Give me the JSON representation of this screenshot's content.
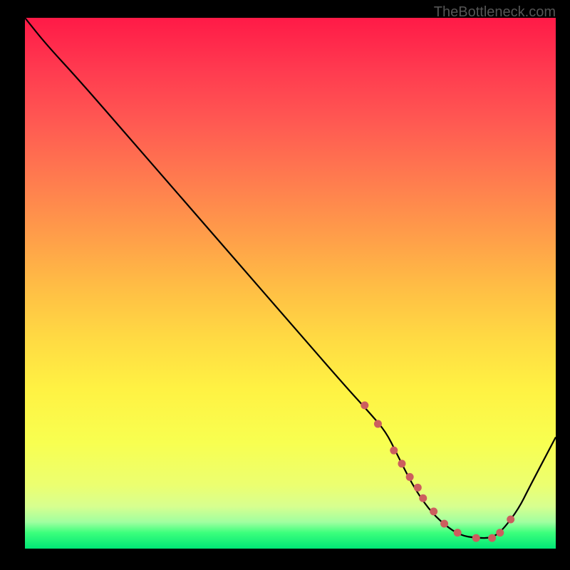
{
  "attribution": "TheBottleneck.com",
  "chart_data": {
    "type": "line",
    "title": "",
    "xlabel": "",
    "ylabel": "",
    "xlim": [
      0,
      100
    ],
    "ylim": [
      0,
      100
    ],
    "grid": false,
    "legend": false,
    "series": [
      {
        "name": "bottleneck-curve",
        "color": "#000000",
        "x": [
          0,
          4,
          10,
          20,
          30,
          40,
          50,
          60,
          65,
          68,
          70,
          73,
          76,
          79,
          82,
          85,
          88,
          90,
          93,
          95,
          100
        ],
        "values": [
          100,
          95,
          88.5,
          77,
          65.5,
          54,
          42.5,
          31,
          25.5,
          22,
          18,
          12,
          7.5,
          4.5,
          2.5,
          2,
          2,
          3.5,
          7.5,
          11.5,
          21
        ]
      }
    ],
    "markers": {
      "name": "highlight-dots",
      "color": "#cc5e5e",
      "x": [
        64,
        66.5,
        69.5,
        71,
        72.5,
        74,
        75,
        77,
        79,
        81.5,
        85,
        88,
        89.5,
        91.5
      ],
      "values": [
        27,
        23.5,
        18.5,
        16,
        13.5,
        11.5,
        9.5,
        7,
        4.7,
        3,
        2,
        2,
        3,
        5.5
      ]
    }
  }
}
